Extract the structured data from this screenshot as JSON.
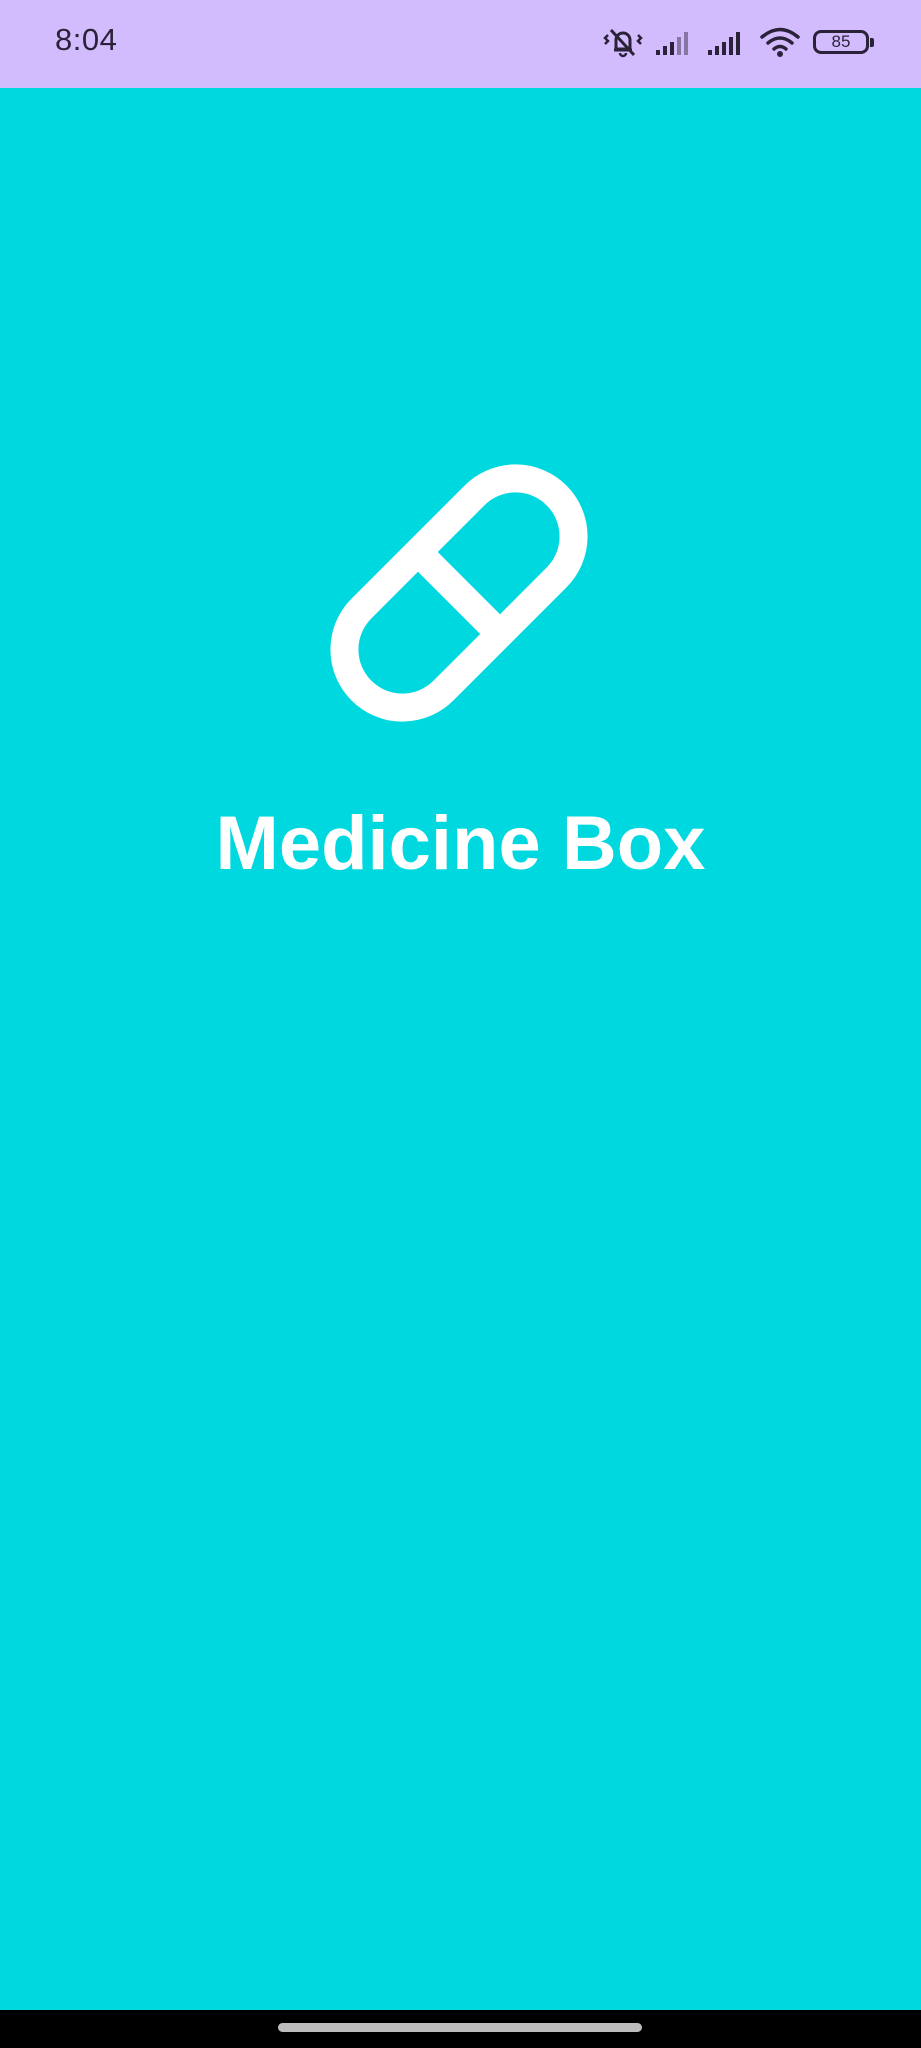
{
  "status_bar": {
    "time": "8:04",
    "battery_level": "85",
    "icons": [
      "vibrate-silent-icon",
      "signal-icon",
      "signal-icon",
      "wifi-icon",
      "battery-icon"
    ]
  },
  "app": {
    "logo_icon": "pill-capsule-icon",
    "title": "Medicine Box"
  },
  "colors": {
    "background": "#00d8e0",
    "status_bar": "#d3bcfe",
    "foreground": "#ffffff"
  }
}
